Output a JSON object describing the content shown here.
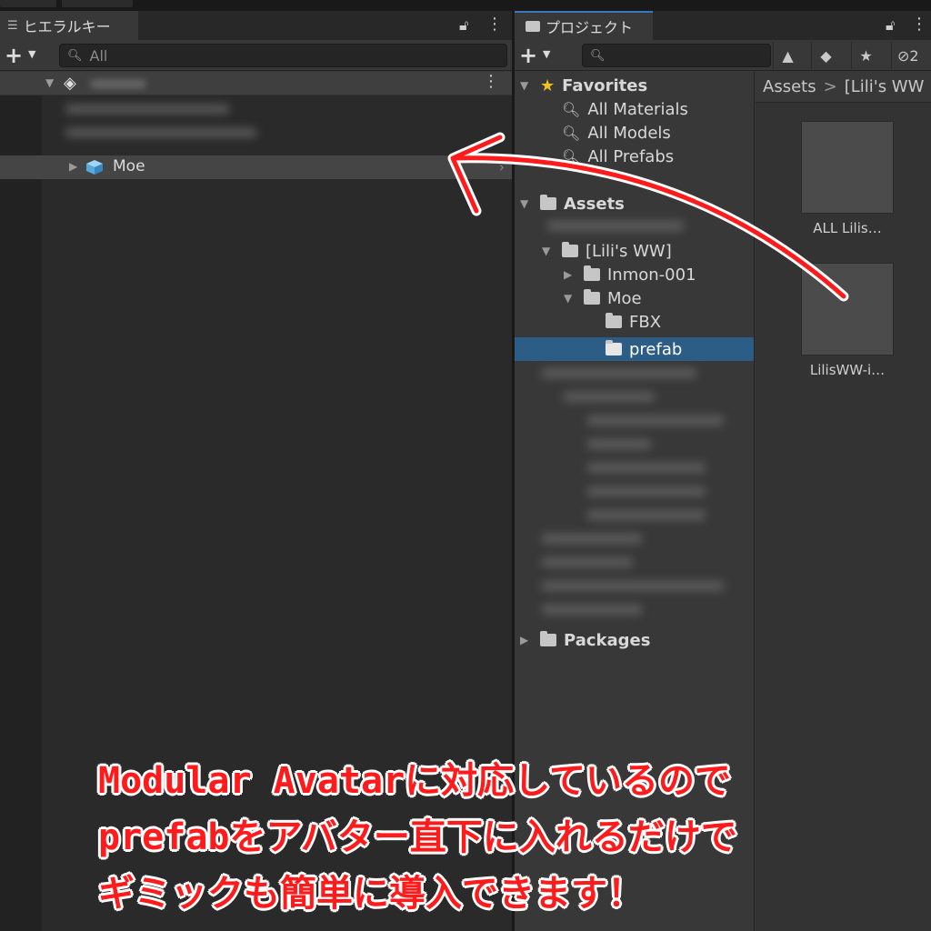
{
  "hierarchy": {
    "tab_title": "ヒエラルキー",
    "tab_icon": "list-icon",
    "search_placeholder": "All",
    "items": [
      {
        "label": "Moe",
        "icon": "prefab-cube-icon"
      }
    ]
  },
  "project": {
    "tab_title": "プロジェクト",
    "toolbar_hidden_count": "2",
    "favorites": {
      "label": "Favorites",
      "items": [
        "All Materials",
        "All Models",
        "All Prefabs"
      ]
    },
    "assets": {
      "label": "Assets",
      "tree": [
        {
          "label": "[Lili's WW]"
        },
        {
          "label": "Inmon-001"
        },
        {
          "label": "Moe"
        },
        {
          "label": "FBX"
        },
        {
          "label": "prefab",
          "selected": true
        }
      ]
    },
    "packages": {
      "label": "Packages"
    },
    "breadcrumb": {
      "root": "Assets",
      "sep": ">",
      "current": "[Lili's WW"
    },
    "grid_items": [
      {
        "label": "ALL Lilis…"
      },
      {
        "label": "LilisWW-i…"
      }
    ]
  },
  "caption": {
    "line1": "Modular Avatarに対応しているので",
    "line2": "prefabをアバター直下に入れるだけで",
    "line3": "ギミックも簡単に導入できます！"
  },
  "colors": {
    "accent": "#ff1b1b",
    "selection": "#2c5d87",
    "tab_highlight": "#3a79bb"
  }
}
